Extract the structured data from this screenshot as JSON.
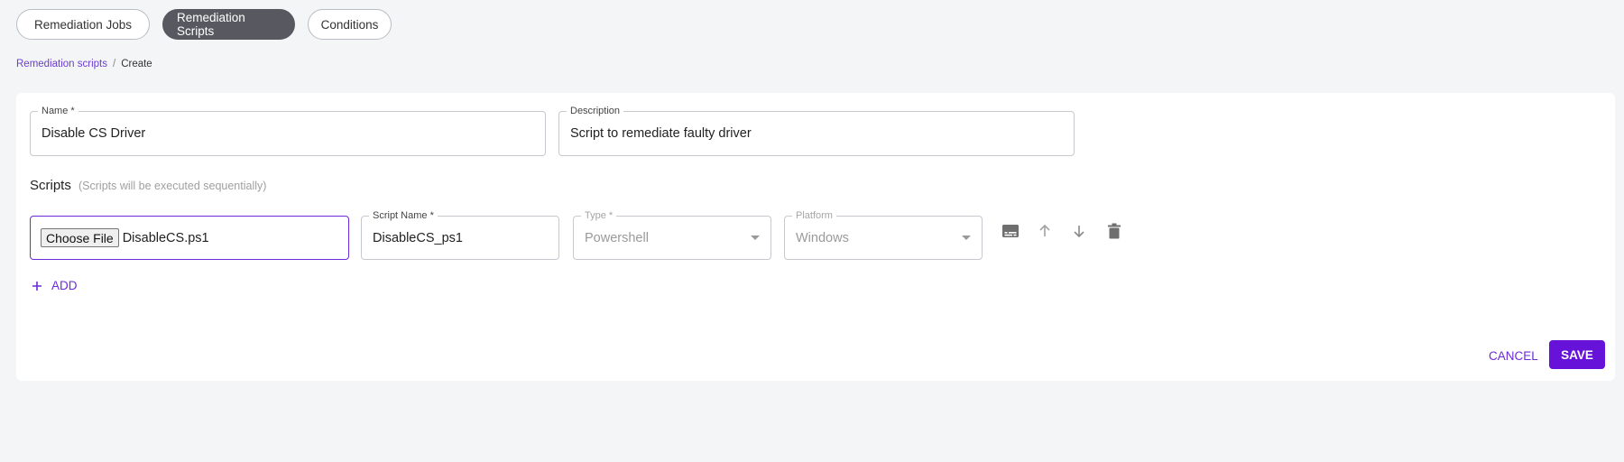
{
  "tabs": [
    {
      "label": "Remediation Jobs",
      "active": false
    },
    {
      "label": "Remediation Scripts",
      "active": true
    },
    {
      "label": "Conditions",
      "active": false
    }
  ],
  "breadcrumb": {
    "parent": "Remediation scripts",
    "separator": "/",
    "current": "Create"
  },
  "form": {
    "name": {
      "label": "Name *",
      "value": "Disable CS Driver"
    },
    "description": {
      "label": "Description",
      "value": "Script to remediate faulty driver"
    }
  },
  "scripts": {
    "title": "Scripts",
    "note": "(Scripts will be executed sequentially)",
    "rows": [
      {
        "file_button": "Choose File",
        "file_name": "DisableCS.ps1",
        "script_name": {
          "label": "Script Name *",
          "value": "DisableCS_ps1"
        },
        "type": {
          "label": "Type *",
          "value": "Powershell"
        },
        "platform": {
          "label": "Platform",
          "value": "Windows"
        },
        "action_icons": [
          "subtitles-icon",
          "arrow-up-icon",
          "arrow-down-icon",
          "delete-icon"
        ]
      }
    ],
    "add_label": "ADD"
  },
  "actions": {
    "cancel": "CANCEL",
    "save": "SAVE"
  },
  "colors": {
    "accent": "#6c2bd9",
    "save_bg": "#6612d9",
    "active_tab": "#575860"
  }
}
